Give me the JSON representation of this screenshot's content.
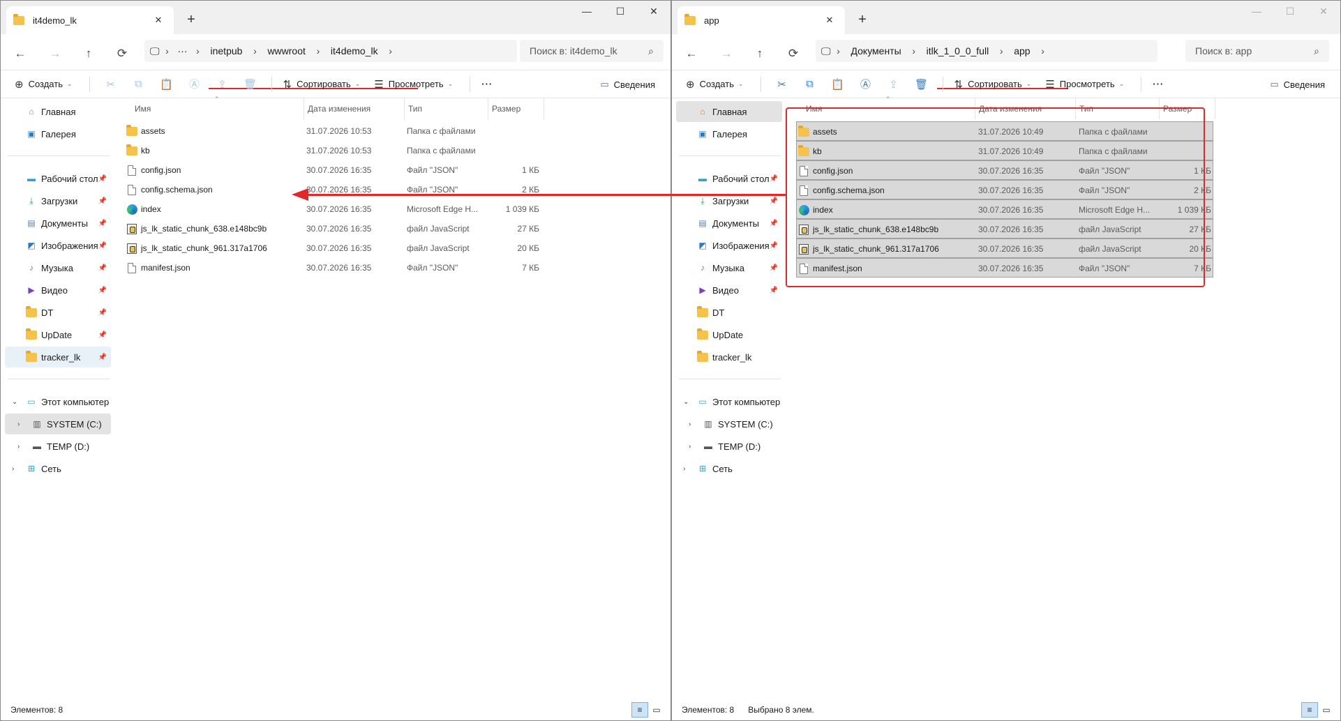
{
  "left": {
    "tab_title": "it4demo_lk",
    "breadcrumb": [
      "inetpub",
      "wwwroot",
      "it4demo_lk"
    ],
    "search_placeholder": "Поиск в: it4demo_lk",
    "status_count": "Элементов: 8",
    "status_selected": "",
    "files": [
      {
        "name": "assets",
        "date": "31.07.2026 10:53",
        "type": "Папка с файлами",
        "size": "",
        "icon": "folder-icon"
      },
      {
        "name": "kb",
        "date": "31.07.2026 10:53",
        "type": "Папка с файлами",
        "size": "",
        "icon": "folder-icon"
      },
      {
        "name": "config.json",
        "date": "30.07.2026 16:35",
        "type": "Файл \"JSON\"",
        "size": "1 КБ",
        "icon": "json-file-icon"
      },
      {
        "name": "config.schema.json",
        "date": "30.07.2026 16:35",
        "type": "Файл \"JSON\"",
        "size": "2 КБ",
        "icon": "json-file-icon"
      },
      {
        "name": "index",
        "date": "30.07.2026 16:35",
        "type": "Microsoft Edge H...",
        "size": "1 039 КБ",
        "icon": "edge-html-icon"
      },
      {
        "name": "js_lk_static_chunk_638.e148bc9b",
        "date": "30.07.2026 16:35",
        "type": "файл JavaScript",
        "size": "27 КБ",
        "icon": "js-file-icon"
      },
      {
        "name": "js_lk_static_chunk_961.317a1706",
        "date": "30.07.2026 16:35",
        "type": "файл JavaScript",
        "size": "20 КБ",
        "icon": "js-file-icon"
      },
      {
        "name": "manifest.json",
        "date": "30.07.2026 16:35",
        "type": "Файл \"JSON\"",
        "size": "7 КБ",
        "icon": "json-file-icon"
      }
    ]
  },
  "right": {
    "tab_title": "app",
    "breadcrumb": [
      "Документы",
      "itlk_1_0_0_full",
      "app"
    ],
    "search_placeholder": "Поиск в: app",
    "status_count": "Элементов: 8",
    "status_selected": "Выбрано 8 элем.",
    "files": [
      {
        "name": "assets",
        "date": "31.07.2026 10:49",
        "type": "Папка с файлами",
        "size": "",
        "icon": "folder-icon"
      },
      {
        "name": "kb",
        "date": "31.07.2026 10:49",
        "type": "Папка с файлами",
        "size": "",
        "icon": "folder-icon"
      },
      {
        "name": "config.json",
        "date": "30.07.2026 16:35",
        "type": "Файл \"JSON\"",
        "size": "1 КБ",
        "icon": "json-file-icon"
      },
      {
        "name": "config.schema.json",
        "date": "30.07.2026 16:35",
        "type": "Файл \"JSON\"",
        "size": "2 КБ",
        "icon": "json-file-icon"
      },
      {
        "name": "index",
        "date": "30.07.2026 16:35",
        "type": "Microsoft Edge H...",
        "size": "1 039 КБ",
        "icon": "edge-html-icon"
      },
      {
        "name": "js_lk_static_chunk_638.e148bc9b",
        "date": "30.07.2026 16:35",
        "type": "файл JavaScript",
        "size": "27 КБ",
        "icon": "js-file-icon"
      },
      {
        "name": "js_lk_static_chunk_961.317a1706",
        "date": "30.07.2026 16:35",
        "type": "файл JavaScript",
        "size": "20 КБ",
        "icon": "js-file-icon"
      },
      {
        "name": "manifest.json",
        "date": "30.07.2026 16:35",
        "type": "Файл \"JSON\"",
        "size": "7 КБ",
        "icon": "json-file-icon"
      }
    ]
  },
  "toolbar": {
    "create": "Создать",
    "sort": "Сортировать",
    "view": "Просмотреть",
    "more": "···",
    "details": "Сведения"
  },
  "columns": {
    "name": "Имя",
    "date": "Дата изменения",
    "type": "Тип",
    "size": "Размер"
  },
  "sidebar": {
    "home": "Главная",
    "gallery": "Галерея",
    "pinned": [
      "Рабочий стол",
      "Загрузки",
      "Документы",
      "Изображения",
      "Музыка",
      "Видео",
      "DT",
      "UpDate",
      "tracker_lk"
    ],
    "this_pc": "Этот компьютер",
    "drives": [
      "SYSTEM (C:)",
      "TEMP (D:)"
    ],
    "network": "Сеть"
  },
  "colors": {
    "annotation": "#e0282b",
    "accent": "#2e78c6",
    "selection": "#d9d9d9"
  }
}
